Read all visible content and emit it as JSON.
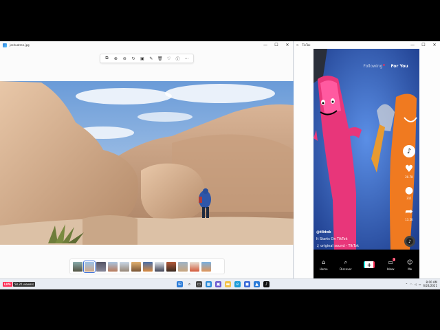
{
  "photos": {
    "title": "joshuatree.jpg",
    "toolbar_icons": [
      "crop-icon",
      "zoom-in-icon",
      "zoom-out-icon",
      "rotate-icon",
      "edit-icon",
      "draw-icon",
      "delete-icon",
      "favorite-icon",
      "info-icon",
      "more-icon"
    ],
    "filmstrip_count": 13,
    "selected_thumb_index": 1
  },
  "window_controls": {
    "minimize": "—",
    "maximize": "☐",
    "close": "✕"
  },
  "tiktok": {
    "title": "TikTok",
    "tabs": {
      "following": "Following",
      "for_you": "For You"
    },
    "likes": "20.7K",
    "comments": "311",
    "shares": "13.5K",
    "handle": "@tiktok",
    "caption": "It Starts On TikTok",
    "sound": "original sound - TikTok",
    "nav": {
      "home": "Home",
      "discover": "Discover",
      "inbox": "Inbox",
      "me": "Me"
    },
    "inbox_badge": "3"
  },
  "taskbar": {
    "live_label": "LIVE",
    "viewers": "58.2K viewers",
    "time": "8:00 AM",
    "date": "6/24/2021"
  },
  "colors": {
    "tiktok_red": "#fe2c55",
    "tiktok_cyan": "#25f4ee",
    "accent": "#3b6fd8"
  }
}
